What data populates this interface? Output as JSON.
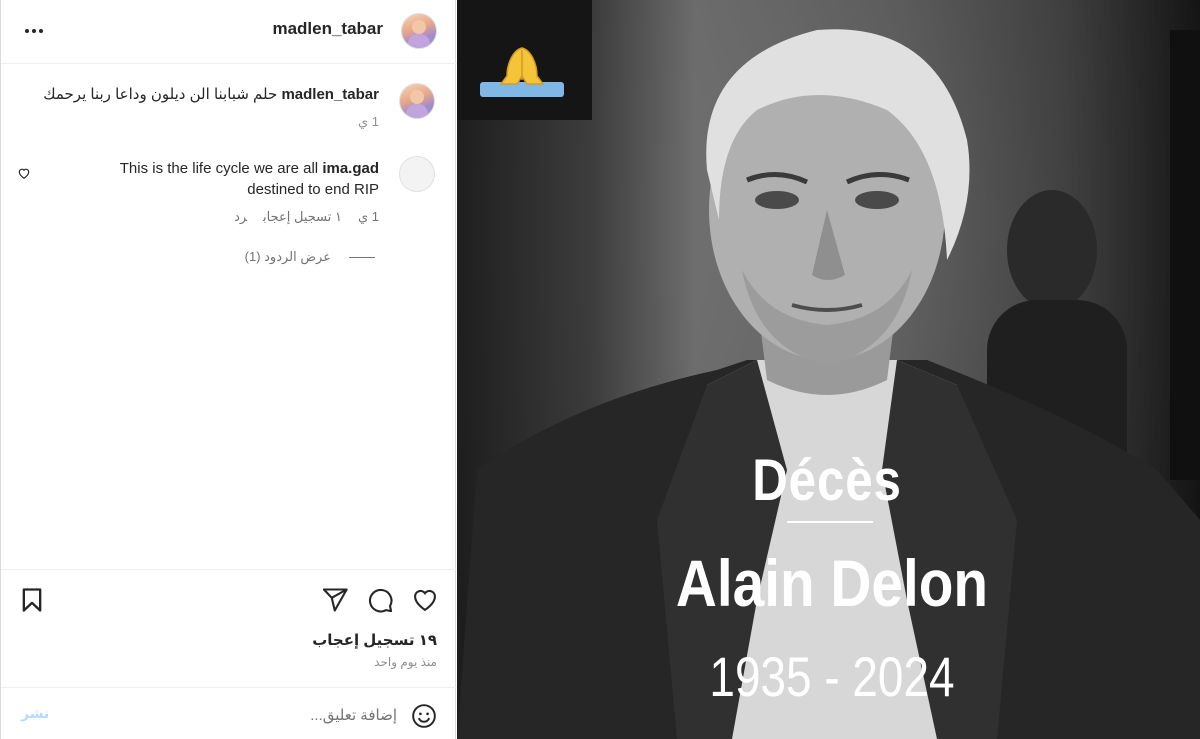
{
  "header": {
    "username": "madlen_tabar",
    "more_icon": "ellipsis-icon"
  },
  "caption": {
    "username": "madlen_tabar",
    "text": "حلم شبابنا الن ديلون وداعا ربنا يرحمك",
    "time": "1 ي"
  },
  "comment": {
    "username": "ima.gad",
    "text": "This is the life cycle we are all",
    "text_line2": "destined to end RIP",
    "time": "1 ي",
    "likes": "١ تسجيل إعجاب",
    "reply": "رد",
    "view_replies": "عرض الردود (1)"
  },
  "actions": {
    "likes": "١٩ تسجيل إعجاب",
    "posted": "منذ يوم واحد",
    "icons": [
      "heart-icon",
      "comment-icon",
      "share-icon",
      "bookmark-icon"
    ]
  },
  "add_comment": {
    "placeholder": "إضافة تعليق...",
    "post_label": "نشر",
    "post_color": "#b3dbff"
  },
  "post_image": {
    "emoji": "🙏",
    "title": "Décès",
    "name": "Alain Delon",
    "years": "1935 - 2024"
  }
}
